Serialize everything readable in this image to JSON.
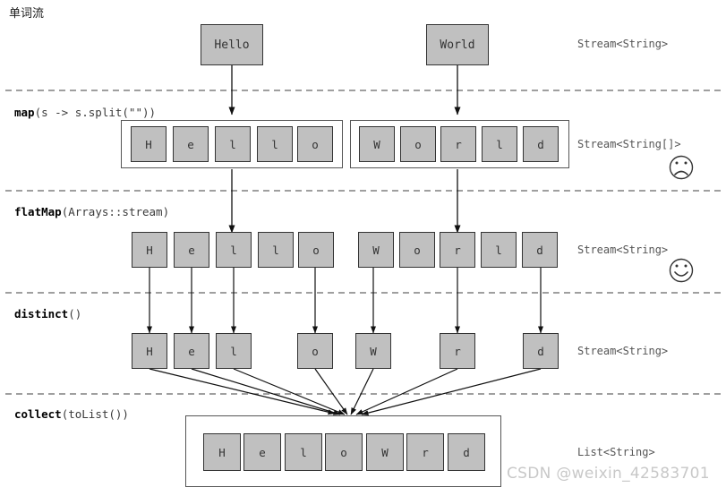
{
  "title": "单词流",
  "watermark": "CSDN @weixin_42583701",
  "colors": {
    "cell_fill": "#c0c0c0",
    "cell_stroke": "#333333",
    "container_stroke": "#555555",
    "divider": "#666666",
    "watermark": "#c8c8c8",
    "background": "#ffffff"
  },
  "stages": [
    {
      "id": "source",
      "operation_bold": "",
      "operation_rest": "",
      "type_label": "Stream<String>",
      "boxes": [
        "Hello",
        "World"
      ],
      "face": null
    },
    {
      "id": "map",
      "operation_bold": "map",
      "operation_rest": "(s -> s.split(\"\"))",
      "type_label": "Stream<String[]>",
      "arrays": [
        [
          "H",
          "e",
          "l",
          "l",
          "o"
        ],
        [
          "W",
          "o",
          "r",
          "l",
          "d"
        ]
      ],
      "face": "sad-face-icon"
    },
    {
      "id": "flatMap",
      "operation_bold": "flatMap",
      "operation_rest": "(Arrays::stream)",
      "type_label": "Stream<String>",
      "cells": [
        "H",
        "e",
        "l",
        "l",
        "o",
        "W",
        "o",
        "r",
        "l",
        "d"
      ],
      "face": "happy-face-icon"
    },
    {
      "id": "distinct",
      "operation_bold": "distinct",
      "operation_rest": "()",
      "type_label": "Stream<String>",
      "cells": [
        "H",
        "e",
        "l",
        "o",
        "W",
        "r",
        "d"
      ],
      "face": null
    },
    {
      "id": "collect",
      "operation_bold": "collect",
      "operation_rest": "(toList())",
      "type_label": "List<String>",
      "cells": [
        "H",
        "e",
        "l",
        "o",
        "W",
        "r",
        "d"
      ],
      "face": null
    }
  ]
}
